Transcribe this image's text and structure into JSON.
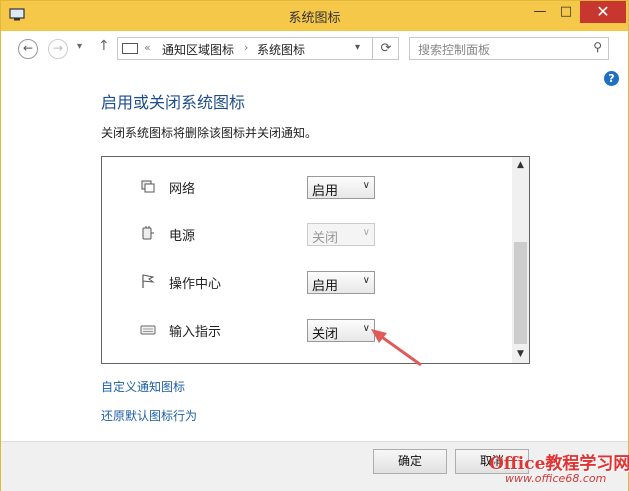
{
  "window": {
    "title": "系统图标"
  },
  "nav": {
    "breadcrumb": [
      "通知区域图标",
      "系统图标"
    ],
    "search_placeholder": "搜索控制面板"
  },
  "main": {
    "heading": "启用或关闭系统图标",
    "description": "关闭系统图标将删除该图标并关闭通知。",
    "rows": [
      {
        "name": "网络",
        "icon": "network-icon",
        "value": "启用",
        "enabled": true
      },
      {
        "name": "电源",
        "icon": "power-icon",
        "value": "关闭",
        "enabled": false
      },
      {
        "name": "操作中心",
        "icon": "flag-icon",
        "value": "启用",
        "enabled": true
      },
      {
        "name": "输入指示",
        "icon": "keyboard-icon",
        "value": "关闭",
        "enabled": true
      }
    ],
    "links": [
      "自定义通知图标",
      "还原默认图标行为"
    ]
  },
  "footer": {
    "ok_label": "确定",
    "cancel_label": "取消"
  },
  "watermark": {
    "line1": "Office教程学习网",
    "line2": "www.office68.com"
  },
  "colors": {
    "titlebar": "#f6c84a",
    "close": "#c7372f",
    "link": "#1e5fa8",
    "heading": "#1e4e8c",
    "annotation_arrow": "#e05a5a"
  }
}
